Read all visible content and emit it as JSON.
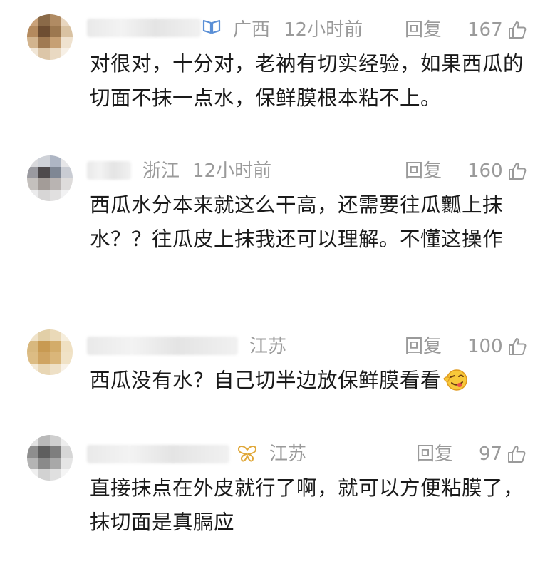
{
  "comments": [
    {
      "location": "广西",
      "time": "12小时前",
      "reply_label": "回复",
      "likes": "167",
      "text": "对很对，十分对，老衲有切实经验，如果西瓜的切面不抹一点水，保鲜膜根本粘不上。",
      "badge_icon": "open-book-icon",
      "badge_color": "#5a8fd6"
    },
    {
      "location": "浙江",
      "time": "12小时前",
      "reply_label": "回复",
      "likes": "160",
      "text": "西瓜水分本来就这么干高，还需要往瓜瓤上抹水？？往瓜皮上抹我还可以理解。不懂这操作"
    },
    {
      "location": "江苏",
      "time": "",
      "reply_label": "回复",
      "likes": "100",
      "text": "西瓜没有水？自己切半边放保鲜膜看看",
      "emoji": "wink-tongue-emoji"
    },
    {
      "location": "江苏",
      "time": "",
      "reply_label": "回复",
      "likes": "97",
      "text": "直接抹点在外皮就行了啊，就可以方便粘膜了，抹切面是真膈应",
      "badge_icon": "butterfly-icon",
      "badge_color": "#e0a83a"
    }
  ],
  "colors": {
    "meta_text": "#9a9a9a",
    "body_text": "#1a1a1a",
    "background": "#ffffff"
  }
}
